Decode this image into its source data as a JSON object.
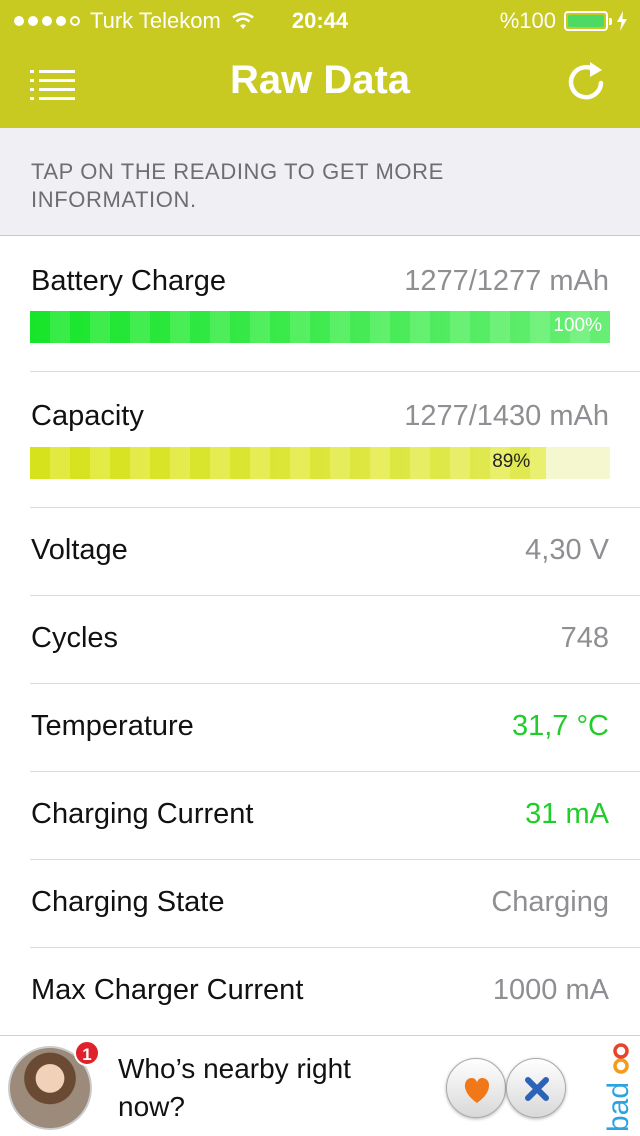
{
  "status_bar": {
    "carrier": "Turk Telekom",
    "time": "20:44",
    "battery_text": "%100"
  },
  "nav": {
    "title": "Raw Data",
    "menu_icon": "list-icon",
    "refresh_icon": "refresh-icon"
  },
  "info": {
    "text": "TAP ON THE READING TO GET MORE INFORMATION."
  },
  "readings": {
    "battery_charge": {
      "label": "Battery Charge",
      "value": "1277/1277 mAh",
      "percent": 100,
      "percent_text": "100%",
      "color": "#17e52a"
    },
    "capacity": {
      "label": "Capacity",
      "value": "1277/1430 mAh",
      "percent": 89,
      "percent_text": "89%",
      "color": "#d6e21a"
    },
    "voltage": {
      "label": "Voltage",
      "value": "4,30 V"
    },
    "cycles": {
      "label": "Cycles",
      "value": "748"
    },
    "temperature": {
      "label": "Temperature",
      "value": "31,7 °C",
      "color": "#1fce28"
    },
    "charging_current": {
      "label": "Charging Current",
      "value": "31 mA",
      "color": "#1fce28"
    },
    "charging_state": {
      "label": "Charging State",
      "value": "Charging"
    },
    "max_charger_current": {
      "label": "Max Charger Current",
      "value": "1000 mA"
    }
  },
  "ad": {
    "badge_count": "1",
    "text": "Who’s nearby right now?",
    "brand": "badoo",
    "like_icon": "heart-icon",
    "dismiss_icon": "close-icon"
  },
  "colors": {
    "header": "#c8c921",
    "info_background": "#efeff4"
  }
}
